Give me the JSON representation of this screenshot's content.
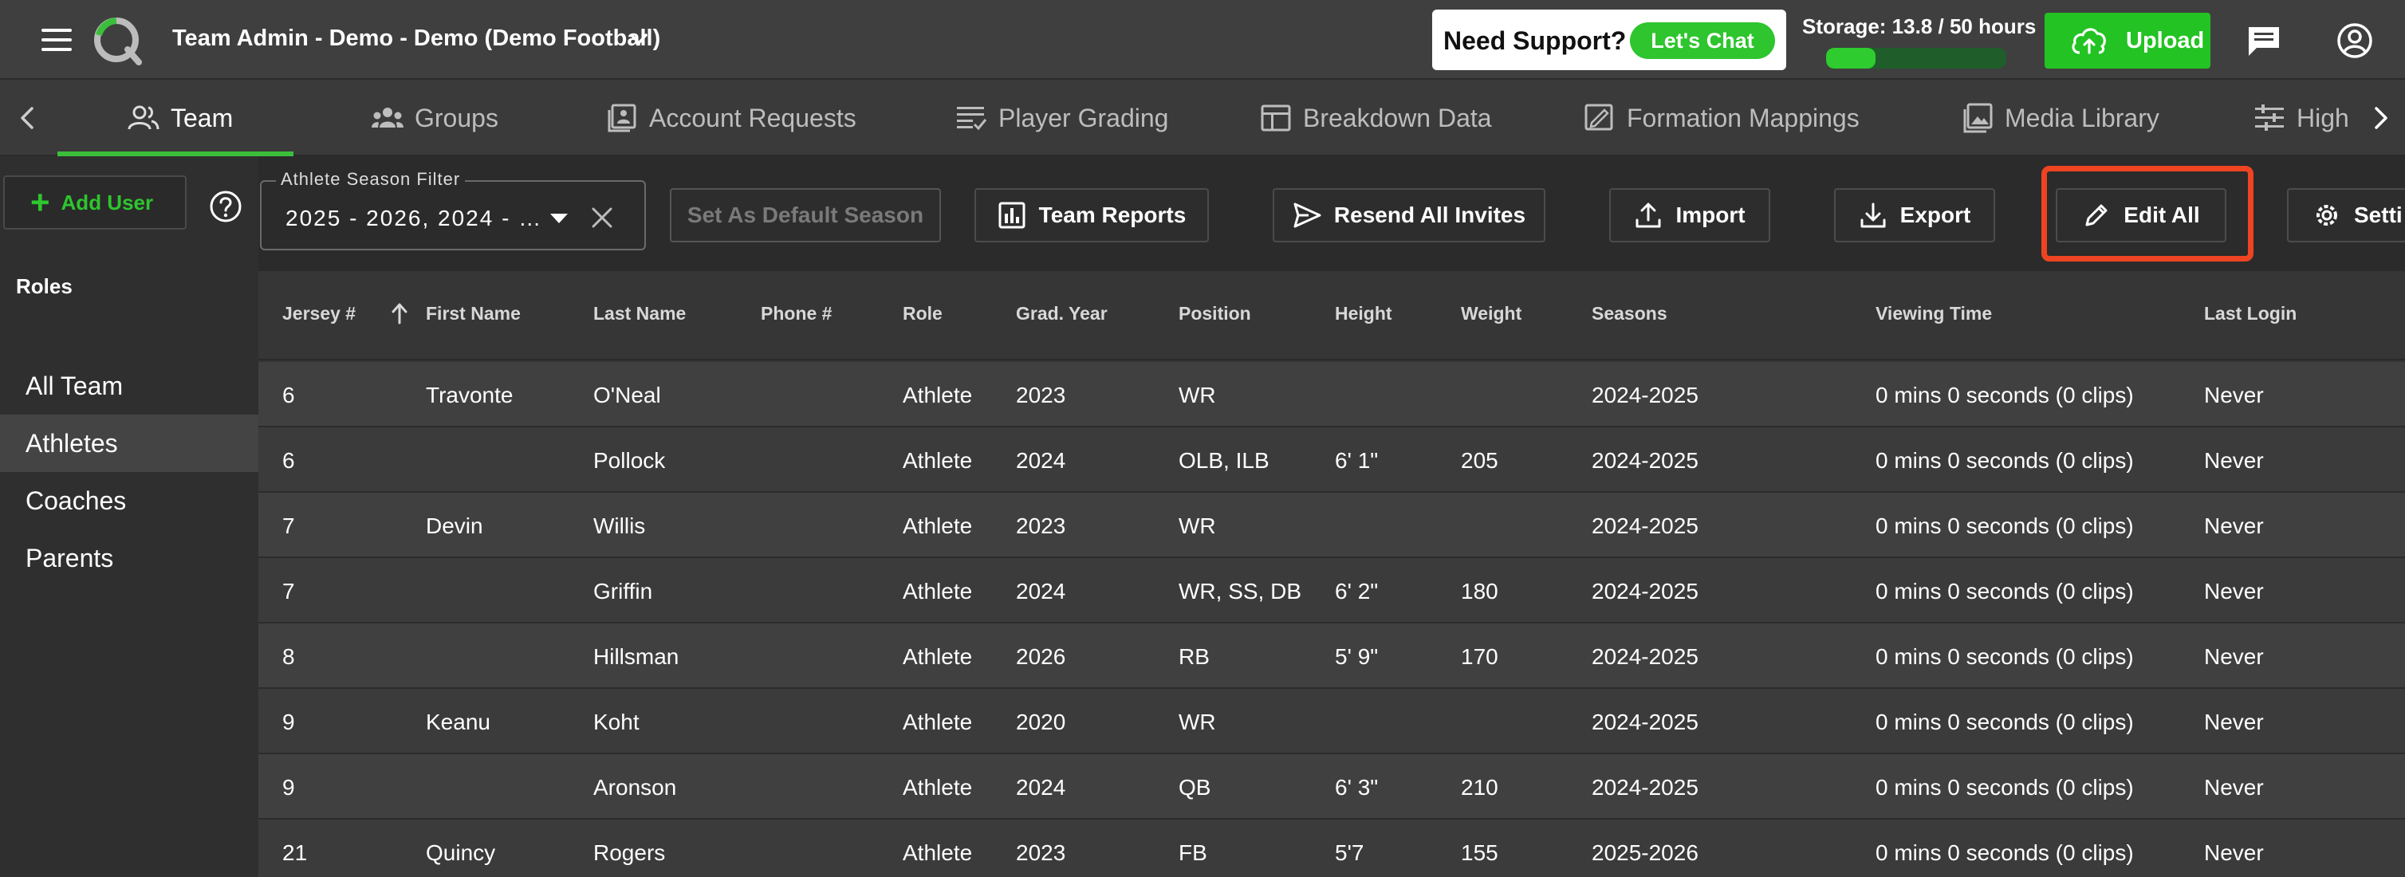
{
  "header": {
    "team_title": "Team Admin - Demo - Demo (Demo Football)",
    "support_text": "Need Support?",
    "chat_label": "Let's Chat",
    "storage_label": "Storage: 13.8 / 50 hours",
    "storage_fraction": 0.276,
    "upload_label": "Upload"
  },
  "colors": {
    "accent_green": "#2ec52e",
    "highlight_red": "#ee4422",
    "background": "#2b2b2b"
  },
  "tabs": [
    {
      "label": "Team",
      "icon": "people-icon",
      "active": true
    },
    {
      "label": "Groups",
      "icon": "groups-icon",
      "active": false
    },
    {
      "label": "Account Requests",
      "icon": "account-requests-icon",
      "active": false
    },
    {
      "label": "Player Grading",
      "icon": "checklist-icon",
      "active": false
    },
    {
      "label": "Breakdown Data",
      "icon": "table-icon",
      "active": false
    },
    {
      "label": "Formation Mappings",
      "icon": "formation-icon",
      "active": false
    },
    {
      "label": "Media Library",
      "icon": "image-icon",
      "active": false
    },
    {
      "label": "High",
      "icon": "sliders-icon",
      "active": false
    }
  ],
  "sidebar": {
    "add_user_label": "Add User",
    "roles_title": "Roles",
    "roles": [
      "All Team",
      "Athletes",
      "Coaches",
      "Parents"
    ],
    "selected_role": "Athletes"
  },
  "toolbar": {
    "season_filter_label": "Athlete Season Filter",
    "season_filter_value": "2025 - 2026, 2024 - …",
    "set_default_label": "Set As Default Season",
    "team_reports_label": "Team Reports",
    "resend_invites_label": "Resend All Invites",
    "import_label": "Import",
    "export_label": "Export",
    "edit_all_label": "Edit All",
    "settings_label": "Setti"
  },
  "table": {
    "columns": [
      "Jersey #",
      "First Name",
      "Last Name",
      "Phone #",
      "Role",
      "Grad. Year",
      "Position",
      "Height",
      "Weight",
      "Seasons",
      "Viewing Time",
      "Last Login"
    ],
    "rows": [
      [
        "6",
        "Travonte",
        "O'Neal",
        "",
        "Athlete",
        "2023",
        "WR",
        "",
        "",
        "2024-2025",
        "0 mins 0 seconds (0 clips)",
        "Never"
      ],
      [
        "6",
        "",
        "Pollock",
        "",
        "Athlete",
        "2024",
        "OLB, ILB",
        "6' 1\"",
        "205",
        "2024-2025",
        "0 mins 0 seconds (0 clips)",
        "Never"
      ],
      [
        "7",
        "Devin",
        "Willis",
        "",
        "Athlete",
        "2023",
        "WR",
        "",
        "",
        "2024-2025",
        "0 mins 0 seconds (0 clips)",
        "Never"
      ],
      [
        "7",
        "",
        "Griffin",
        "",
        "Athlete",
        "2024",
        "WR, SS, DB",
        "6' 2\"",
        "180",
        "2024-2025",
        "0 mins 0 seconds (0 clips)",
        "Never"
      ],
      [
        "8",
        "",
        "Hillsman",
        "",
        "Athlete",
        "2026",
        "RB",
        "5' 9\"",
        "170",
        "2024-2025",
        "0 mins 0 seconds (0 clips)",
        "Never"
      ],
      [
        "9",
        "Keanu",
        "Koht",
        "",
        "Athlete",
        "2020",
        "WR",
        "",
        "",
        "2024-2025",
        "0 mins 0 seconds (0 clips)",
        "Never"
      ],
      [
        "9",
        "",
        "Aronson",
        "",
        "Athlete",
        "2024",
        "QB",
        "6' 3\"",
        "210",
        "2024-2025",
        "0 mins 0 seconds (0 clips)",
        "Never"
      ],
      [
        "21",
        "Quincy",
        "Rogers",
        "",
        "Athlete",
        "2023",
        "FB",
        "5'7",
        "155",
        "2025-2026",
        "0 mins 0 seconds (0 clips)",
        "Never"
      ]
    ]
  }
}
